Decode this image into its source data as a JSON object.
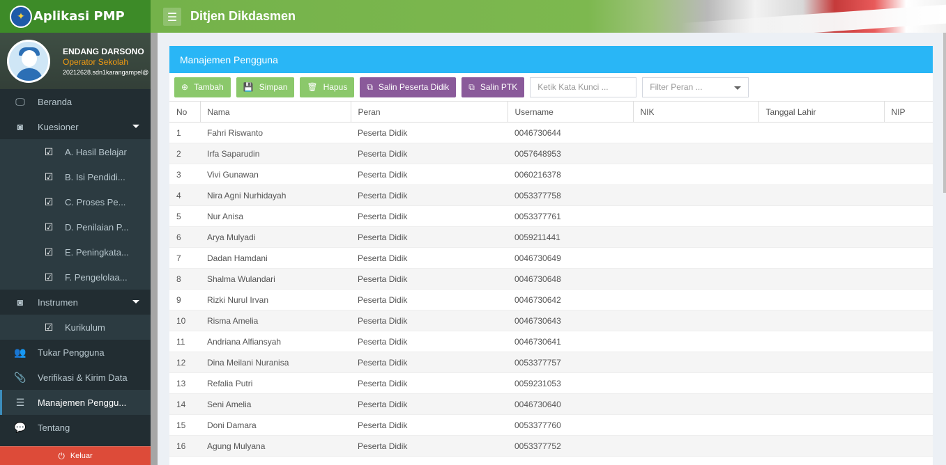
{
  "app": {
    "title": "Aplikasi PMP"
  },
  "header": {
    "title": "Ditjen Dikdasmen"
  },
  "user": {
    "name": "ENDANG DARSONO",
    "role": "Operator Sekolah",
    "email": "20212628.sdn1karangampel@"
  },
  "sidebar": {
    "items": [
      {
        "label": "Beranda",
        "icon": "monitor-icon"
      },
      {
        "label": "Kuesioner",
        "icon": "binoculars-icon"
      },
      {
        "label": "A. Hasil Belajar",
        "icon": "checkbox-icon"
      },
      {
        "label": "B. Isi Pendidi...",
        "icon": "checkbox-icon"
      },
      {
        "label": "C. Proses Pe...",
        "icon": "checkbox-icon"
      },
      {
        "label": "D. Penilaian P...",
        "icon": "checkbox-icon"
      },
      {
        "label": "E. Peningkata...",
        "icon": "checkbox-icon"
      },
      {
        "label": "F. Pengelolaa...",
        "icon": "checkbox-icon"
      },
      {
        "label": "Instrumen",
        "icon": "binoculars-icon"
      },
      {
        "label": "Kurikulum",
        "icon": "checkbox-icon"
      },
      {
        "label": "Tukar Pengguna",
        "icon": "users-icon"
      },
      {
        "label": "Verifikasi & Kirim Data",
        "icon": "paperclip-icon"
      },
      {
        "label": "Manajemen Penggu...",
        "icon": "list-icon"
      },
      {
        "label": "Tentang",
        "icon": "comments-icon"
      }
    ],
    "logout": "Keluar"
  },
  "panel": {
    "title": "Manajemen Pengguna"
  },
  "toolbar": {
    "add": "Tambah",
    "save": "Simpan",
    "delete": "Hapus",
    "copy_students": "Salin Peserta Didik",
    "copy_ptk": "Salin PTK",
    "search_placeholder": "Ketik Kata Kunci ...",
    "filter_placeholder": "Filter Peran ..."
  },
  "table": {
    "columns": [
      "No",
      "Nama",
      "Peran",
      "Username",
      "NIK",
      "Tanggal Lahir",
      "NIP"
    ],
    "rows": [
      [
        "1",
        "Fahri Riswanto",
        "Peserta Didik",
        "0046730644",
        "",
        "",
        ""
      ],
      [
        "2",
        "Irfa Saparudin",
        "Peserta Didik",
        "0057648953",
        "",
        "",
        ""
      ],
      [
        "3",
        "Vivi Gunawan",
        "Peserta Didik",
        "0060216378",
        "",
        "",
        ""
      ],
      [
        "4",
        "Nira Agni Nurhidayah",
        "Peserta Didik",
        "0053377758",
        "",
        "",
        ""
      ],
      [
        "5",
        "Nur Anisa",
        "Peserta Didik",
        "0053377761",
        "",
        "",
        ""
      ],
      [
        "6",
        "Arya Mulyadi",
        "Peserta Didik",
        "0059211441",
        "",
        "",
        ""
      ],
      [
        "7",
        "Dadan Hamdani",
        "Peserta Didik",
        "0046730649",
        "",
        "",
        ""
      ],
      [
        "8",
        "Shalma Wulandari",
        "Peserta Didik",
        "0046730648",
        "",
        "",
        ""
      ],
      [
        "9",
        "Rizki Nurul Irvan",
        "Peserta Didik",
        "0046730642",
        "",
        "",
        ""
      ],
      [
        "10",
        "Risma Amelia",
        "Peserta Didik",
        "0046730643",
        "",
        "",
        ""
      ],
      [
        "11",
        "Andriana Alfiansyah",
        "Peserta Didik",
        "0046730641",
        "",
        "",
        ""
      ],
      [
        "12",
        "Dina Meilani Nuranisa",
        "Peserta Didik",
        "0053377757",
        "",
        "",
        ""
      ],
      [
        "13",
        "Refalia Putri",
        "Peserta Didik",
        "0059231053",
        "",
        "",
        ""
      ],
      [
        "14",
        "Seni Amelia",
        "Peserta Didik",
        "0046730640",
        "",
        "",
        ""
      ],
      [
        "15",
        "Doni Damara",
        "Peserta Didik",
        "0053377760",
        "",
        "",
        ""
      ],
      [
        "16",
        "Agung Mulyana",
        "Peserta Didik",
        "0053377752",
        "",
        "",
        ""
      ]
    ]
  },
  "colors": {
    "brand": "#3d8b28",
    "panel_header": "#29b6f6",
    "btn_green": "#8bc86b",
    "btn_purple": "#8a5a9a",
    "logout": "#dd4b39",
    "sidebar": "#222d32"
  }
}
